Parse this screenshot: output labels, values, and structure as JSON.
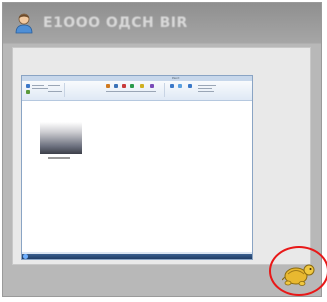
{
  "window": {
    "title": "Е1ООО ОДСН ВІR",
    "title_icon": "user-icon"
  },
  "viewer": {
    "content": "screenshot-thumbnail",
    "ribbon_title": "Paint"
  },
  "corner_button": {
    "icon": "turtle-icon",
    "highlight_color": "#e81818"
  },
  "colors": {
    "accent": "#e81818",
    "title_text": "#d8d8d8",
    "turtle": "#e8b830"
  }
}
